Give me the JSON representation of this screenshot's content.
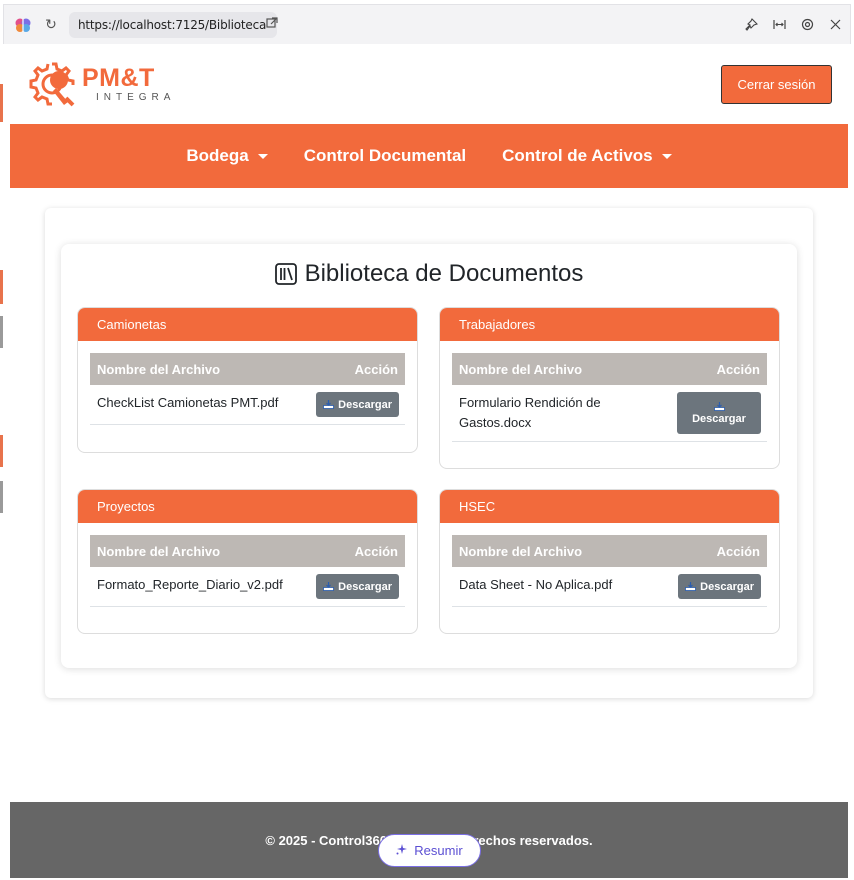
{
  "browser": {
    "url": "https://localhost:7125/Biblioteca"
  },
  "header": {
    "logo_main": "PM&T",
    "logo_sub": "INTEGRA",
    "logout_label": "Cerrar sesión"
  },
  "nav": {
    "items": [
      {
        "label": "Bodega",
        "has_dropdown": true
      },
      {
        "label": "Control Documental",
        "has_dropdown": false
      },
      {
        "label": "Control de Activos",
        "has_dropdown": true
      }
    ]
  },
  "library": {
    "title": "Biblioteca de Documentos",
    "col_name": "Nombre del Archivo",
    "col_action": "Acción",
    "download_label": "Descargar",
    "categories": [
      {
        "name": "Camionetas",
        "files": [
          "CheckList Camionetas PMT.pdf"
        ]
      },
      {
        "name": "Trabajadores",
        "files": [
          "Formulario Rendición de Gastos.docx"
        ]
      },
      {
        "name": "Proyectos",
        "files": [
          "Formato_Reporte_Diario_v2.pdf"
        ]
      },
      {
        "name": "HSEC",
        "files": [
          "Data Sheet - No Aplica.pdf"
        ]
      }
    ]
  },
  "footer": {
    "text": "© 2025 - Control360. Todos los derechos reservados."
  },
  "summarize": {
    "label": "Resumir"
  },
  "colors": {
    "brand": "#f26a3c",
    "table_header": "#bdb8b4",
    "button_secondary": "#6c757d",
    "footer": "#666666"
  }
}
